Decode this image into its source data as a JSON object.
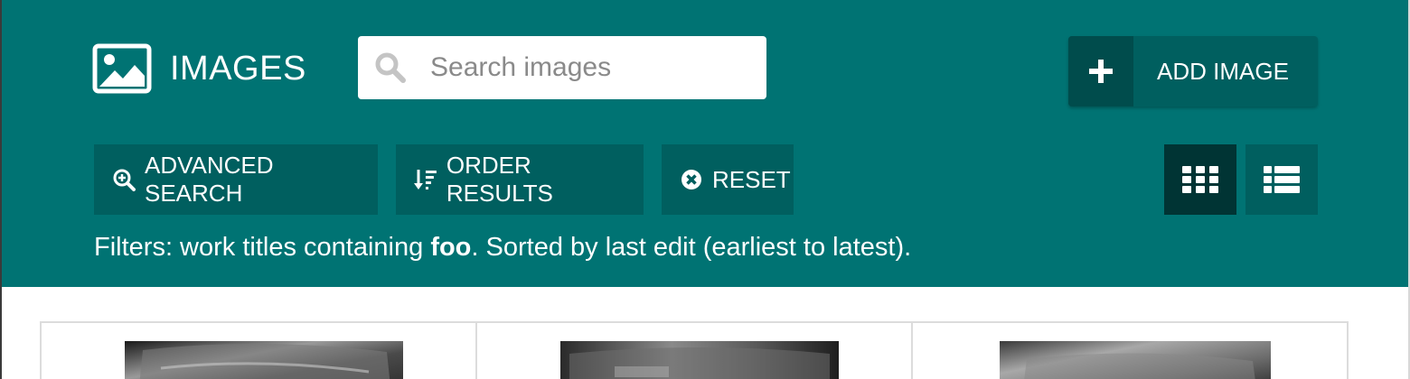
{
  "header": {
    "title": "IMAGES",
    "search": {
      "placeholder": "Search images",
      "value": ""
    },
    "add_button_label": "ADD IMAGE",
    "toolbar": {
      "advanced_search": "ADVANCED SEARCH",
      "order_results": "ORDER RESULTS",
      "reset": "RESET"
    },
    "view_modes": [
      {
        "name": "grid",
        "active": true
      },
      {
        "name": "list",
        "active": false
      }
    ],
    "filters": {
      "prefix": "Filters: work titles containing ",
      "term": "foo",
      "suffix": ". Sorted by last edit (earliest to latest)."
    }
  },
  "colors": {
    "header_bg": "#007373",
    "button_bg": "#005f5f",
    "button_dark": "#004c4c",
    "active_view": "#003434"
  },
  "icons": [
    "image-icon",
    "search-icon",
    "plus-icon",
    "zoom-in-icon",
    "sort-icon",
    "close-circle-icon",
    "grid-view-icon",
    "list-view-icon"
  ],
  "results": [
    {
      "type": "image-thumbnail"
    },
    {
      "type": "image-thumbnail"
    },
    {
      "type": "image-thumbnail"
    }
  ]
}
